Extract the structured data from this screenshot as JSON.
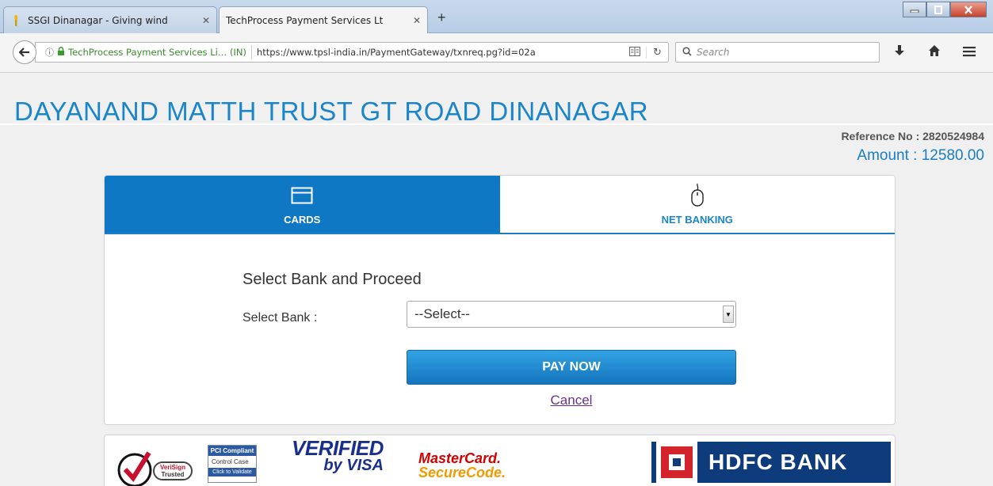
{
  "browser": {
    "tabs": [
      {
        "title": "SSGI Dinanagar - Giving wind",
        "active": false
      },
      {
        "title": "TechProcess Payment Services Lt",
        "active": true
      }
    ],
    "new_tab_glyph": "+",
    "url_info_glyph": "ⓘ",
    "url_org": "TechProcess Payment Services Li… (IN)",
    "url": "https://www.tpsl-india.in/PaymentGateway/txnreq.pg?id=02a",
    "search_placeholder": "Search",
    "window_buttons": [
      "minimize",
      "maximize",
      "close"
    ]
  },
  "page": {
    "merchant_name": "DAYANAND MATTH TRUST GT ROAD DINANAGAR",
    "reference": "Reference No : 2820524984",
    "amount": "Amount : 12580.00",
    "tabs": [
      {
        "label": "CARDS",
        "icon": "card-icon",
        "active": true
      },
      {
        "label": "NET BANKING",
        "icon": "mouse-icon",
        "active": false
      }
    ],
    "section_title": "Select Bank and Proceed",
    "select_label": "Select Bank :",
    "select_value": "--Select--",
    "pay_button": "PAY NOW",
    "cancel_link": "Cancel",
    "logos": {
      "verisign": [
        "VeriSign",
        "Trusted"
      ],
      "pci": {
        "header": "PCI Compliant",
        "middle": "Control Case",
        "footer": "Click to Validate"
      },
      "vbv": {
        "line1": "VERIFIED",
        "line2": "by VISA"
      },
      "mastercard": {
        "line1": "MasterCard.",
        "line2": "SecureCode."
      },
      "hdfc": "HDFC BANK"
    }
  },
  "colors": {
    "accent": "#1a86c9",
    "tab_active_bg": "#0f78c4",
    "cancel_link": "#6b2f8f",
    "hdfc_blue": "#0e3b7b",
    "hdfc_red": "#d4242b"
  }
}
